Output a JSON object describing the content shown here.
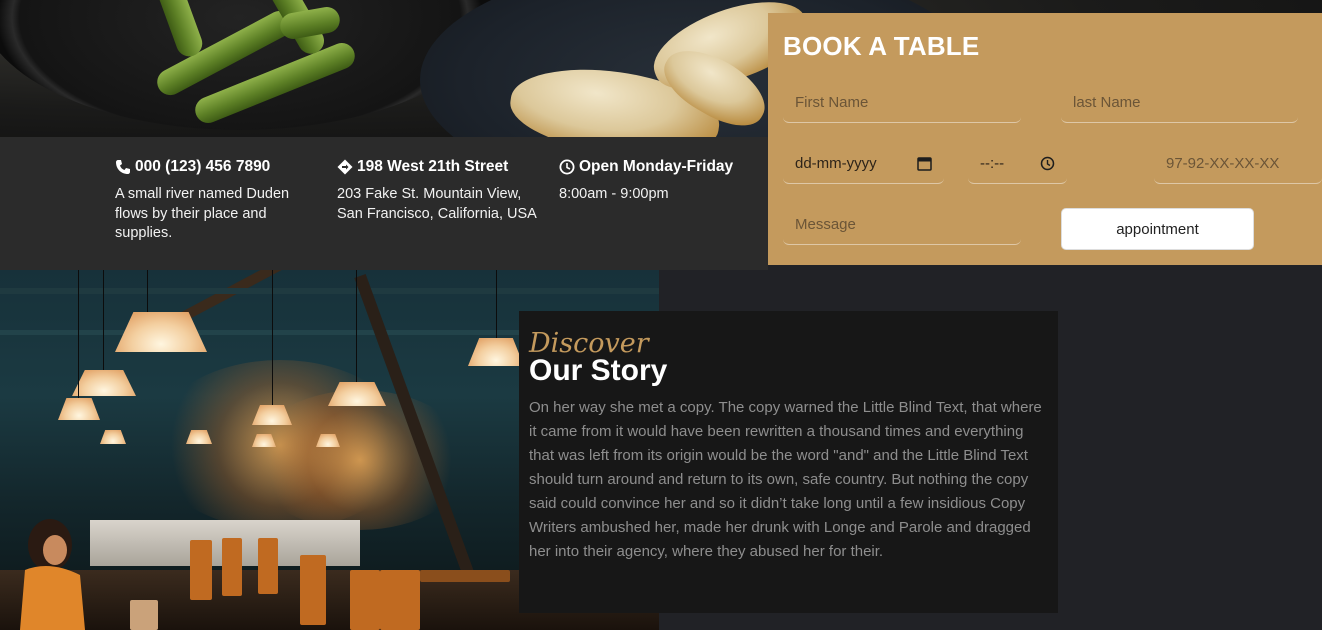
{
  "info": [
    {
      "icon": "phone-icon",
      "heading": "000 (123) 456 7890",
      "desc": "A small river named Duden flows by their place and supplies."
    },
    {
      "icon": "location-icon",
      "heading": "198 West 21th Street",
      "desc": "203 Fake St. Mountain View, San Francisco, California, USA"
    },
    {
      "icon": "clock-icon",
      "heading": "Open Monday-Friday",
      "desc": "8:00am - 9:00pm"
    }
  ],
  "booking": {
    "title": "BOOK A TABLE",
    "first_name_placeholder": "First Name",
    "last_name_placeholder": "last Name",
    "date_placeholder": "dd-mm-yyyy",
    "time_placeholder": "--:--",
    "phone_placeholder": "97-92-XX-XX-XX",
    "message_placeholder": "Message",
    "submit_label": "appointment"
  },
  "story": {
    "kicker": "Discover",
    "title": "Our Story",
    "body": "On her way she met a copy. The copy warned the Little Blind Text, that where it came from it would have been rewritten a thousand times and everything that was left from its origin would be the word \"and\" and the Little Blind Text should turn around and return to its own, safe country. But nothing the copy said could convince her and so it didn’t take long until a few insidious Copy Writers ambushed her, made her drunk with Longe and Parole and dragged her into their agency, where they abused her for their."
  },
  "colors": {
    "accent": "#c49a5d",
    "info_bar": "#2b2b2b",
    "page_bg": "#212226",
    "story_bg": "#171717"
  }
}
